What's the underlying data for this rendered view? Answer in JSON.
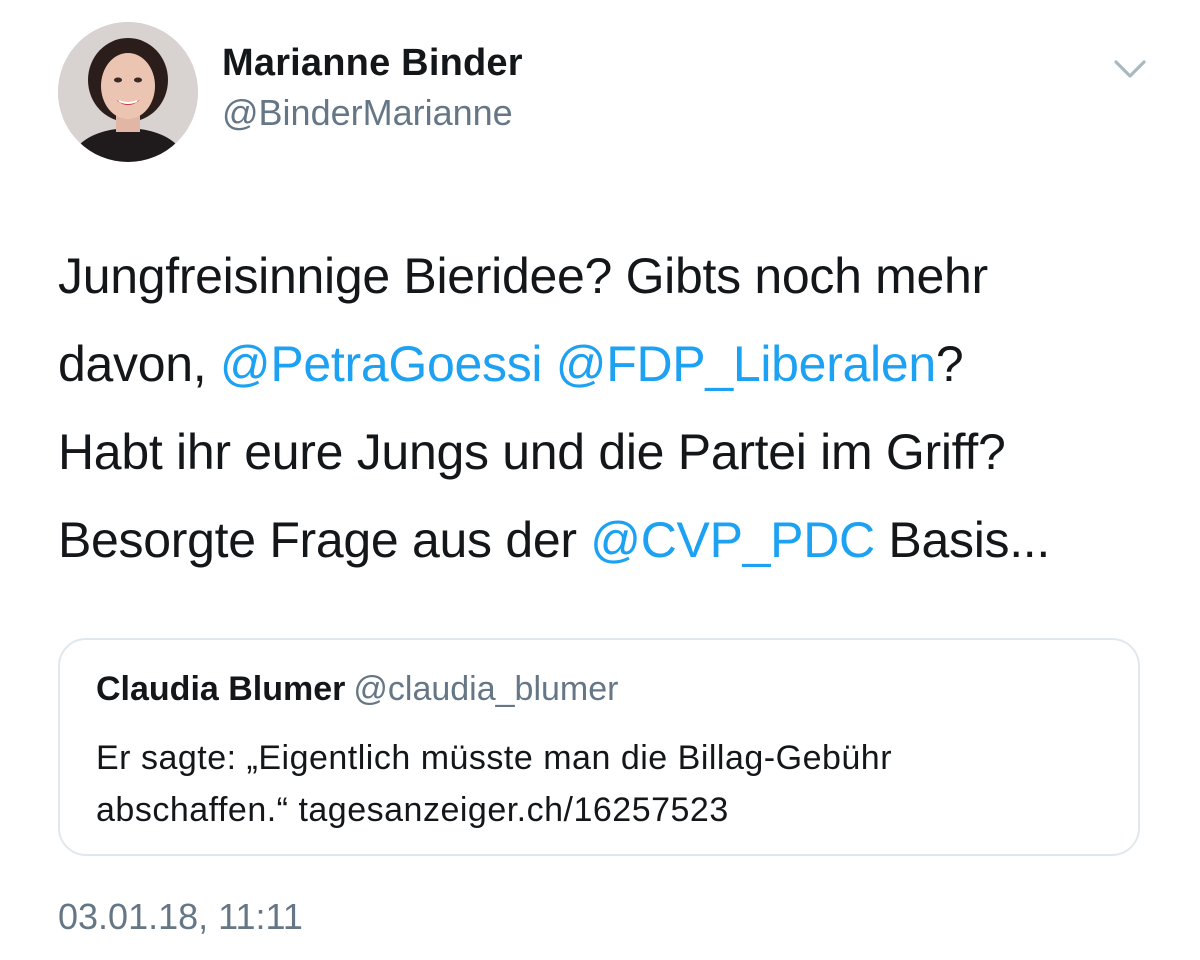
{
  "author": {
    "display_name": "Marianne Binder",
    "handle": "@BinderMarianne"
  },
  "icons": {
    "menu": "chevron-down-icon",
    "menu_color": "#aab8c2"
  },
  "tweet": {
    "lines": [
      [
        {
          "text": "Jungfreisinnige Bieridee?  Gibts noch mehr",
          "type": "text"
        }
      ],
      [
        {
          "text": "davon, ",
          "type": "text"
        },
        {
          "text": "@PetraGoessi",
          "type": "mention"
        },
        {
          "text": " ",
          "type": "text"
        },
        {
          "text": "@FDP_Liberalen",
          "type": "mention"
        },
        {
          "text": "?",
          "type": "text"
        }
      ],
      [
        {
          "text": "Habt ihr eure Jungs und die Partei im Griff?",
          "type": "text"
        }
      ],
      [
        {
          "text": "Besorgte Frage aus der ",
          "type": "text"
        },
        {
          "text": "@CVP_PDC",
          "type": "mention"
        },
        {
          "text": " Basis...",
          "type": "text"
        }
      ]
    ]
  },
  "quoted_tweet": {
    "display_name": "Claudia Blumer",
    "handle": "@claudia_blumer",
    "lines": [
      "Er sagte: „Eigentlich müsste man die Billag-Gebühr",
      "abschaffen.“ tagesanzeiger.ch/16257523"
    ]
  },
  "timestamp": "03.01.18, 11:11",
  "colors": {
    "text": "#14171a",
    "secondary": "#657786",
    "link": "#1da1f2",
    "border": "#e1e8ed"
  }
}
